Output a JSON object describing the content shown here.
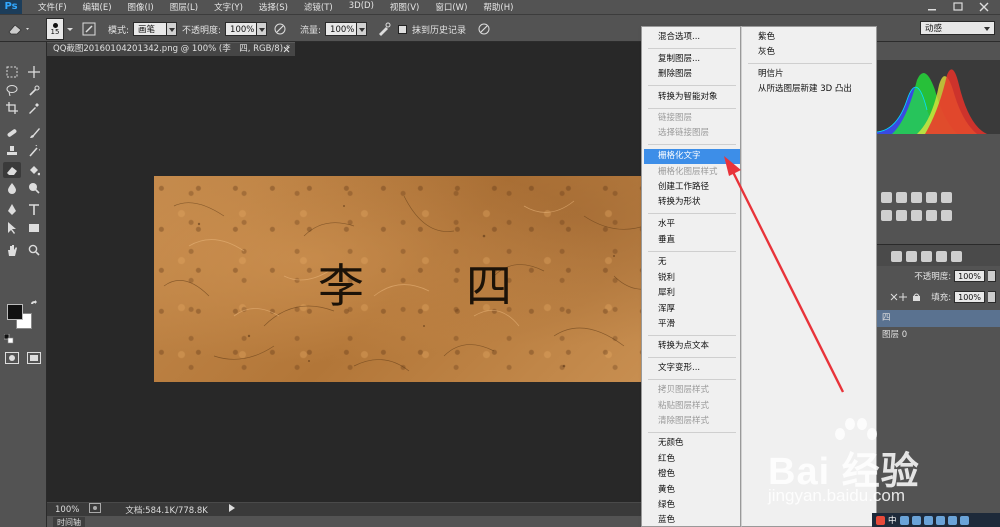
{
  "app": {
    "logo": "Ps",
    "menu": [
      "文件(F)",
      "编辑(E)",
      "图像(I)",
      "图层(L)",
      "文字(Y)",
      "选择(S)",
      "滤镜(T)",
      "3D(D)",
      "视图(V)",
      "窗口(W)",
      "帮助(H)"
    ]
  },
  "options_bar": {
    "brush_size": "15",
    "mode_label": "模式:",
    "mode_value": "画笔",
    "opacity_label": "不透明度:",
    "opacity_value": "100%",
    "flow_label": "流量:",
    "flow_value": "100%",
    "history_label": "抹到历史记录",
    "workspace": "动感"
  },
  "document": {
    "tab_title": "QQ截图20160104201342.png @ 100% (李　四, RGB/8) *",
    "text_content": "李　四",
    "zoom": "100%",
    "doc_size": "文档:584.1K/778.8K",
    "timeline_label": "时间轴"
  },
  "layers_panel": {
    "opacity_label": "不透明度:",
    "opacity_value": "100%",
    "fill_label": "填充:",
    "fill_value": "100%",
    "layers": [
      "四",
      "图层 0"
    ]
  },
  "context_menu": {
    "items": [
      {
        "label": "混合选项...",
        "disabled": false
      },
      {
        "label": "复制图层...",
        "disabled": false
      },
      {
        "label": "删除图层",
        "disabled": false
      },
      {
        "label": "转换为智能对象",
        "disabled": false
      },
      {
        "label": "链接图层",
        "disabled": true
      },
      {
        "label": "选择链接图层",
        "disabled": true
      },
      {
        "label": "栅格化文字",
        "disabled": false,
        "highlight": true
      },
      {
        "label": "栅格化图层样式",
        "disabled": true
      },
      {
        "label": "创建工作路径",
        "disabled": false
      },
      {
        "label": "转换为形状",
        "disabled": false
      },
      {
        "label": "水平",
        "disabled": false
      },
      {
        "label": "垂直",
        "disabled": false
      },
      {
        "label": "无",
        "disabled": false
      },
      {
        "label": "锐利",
        "disabled": false
      },
      {
        "label": "犀利",
        "disabled": false
      },
      {
        "label": "浑厚",
        "disabled": false
      },
      {
        "label": "平滑",
        "disabled": false
      },
      {
        "label": "转换为点文本",
        "disabled": false
      },
      {
        "label": "文字变形...",
        "disabled": false
      },
      {
        "label": "拷贝图层样式",
        "disabled": true
      },
      {
        "label": "粘贴图层样式",
        "disabled": true
      },
      {
        "label": "清除图层样式",
        "disabled": true
      },
      {
        "label": "无颜色",
        "disabled": false
      },
      {
        "label": "红色",
        "disabled": false
      },
      {
        "label": "橙色",
        "disabled": false
      },
      {
        "label": "黄色",
        "disabled": false
      },
      {
        "label": "绿色",
        "disabled": false
      },
      {
        "label": "蓝色",
        "disabled": false
      }
    ],
    "submenu": [
      "紫色",
      "灰色",
      "明信片",
      "从所选图层新建 3D 凸出"
    ]
  },
  "watermark": {
    "brand": "Bai 经验",
    "site": "jingyan.baidu.com"
  },
  "tray": {
    "ime": "中"
  },
  "colors": {
    "highlight": "#3d8ee8",
    "arrow": "#e8333a",
    "panel": "#535353",
    "canvas_bg": "#282828"
  }
}
